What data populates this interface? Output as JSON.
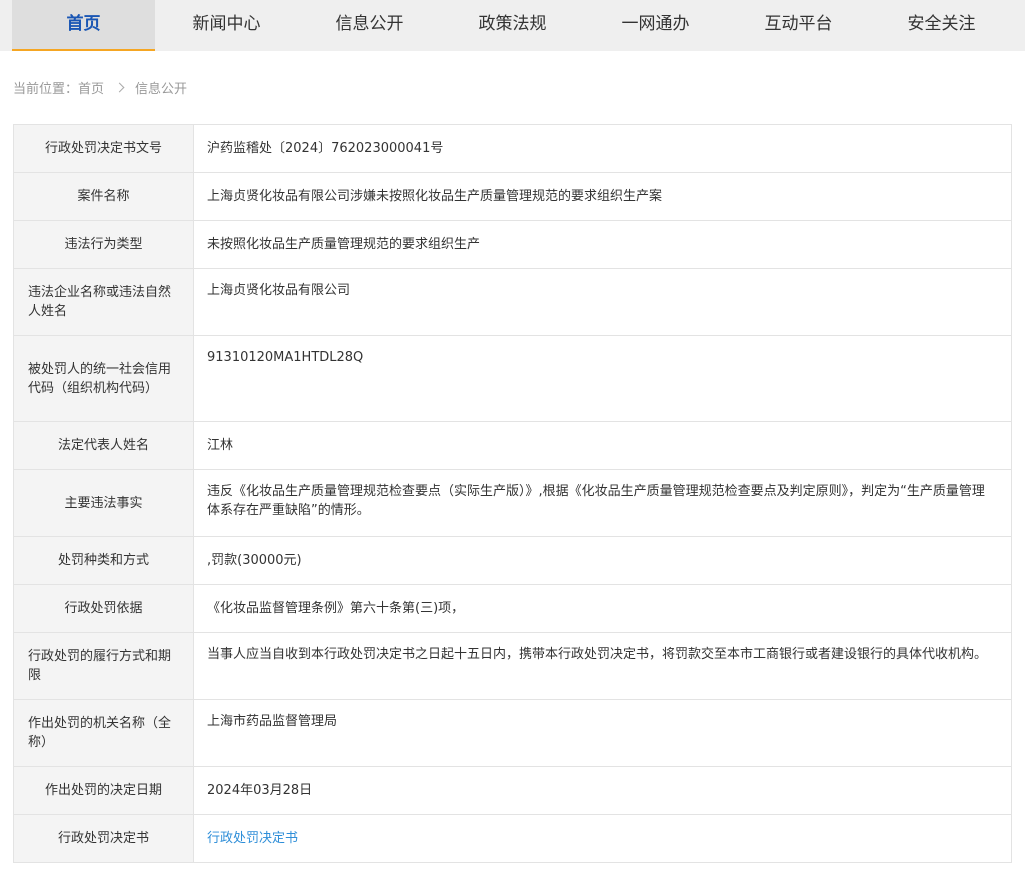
{
  "nav": {
    "items": [
      {
        "label": "首页",
        "active": true
      },
      {
        "label": "新闻中心"
      },
      {
        "label": "信息公开"
      },
      {
        "label": "政策法规"
      },
      {
        "label": "一网通办"
      },
      {
        "label": "互动平台"
      },
      {
        "label": "安全关注"
      }
    ],
    "active_color": "#1a56b4",
    "underline_color": "#f5a623"
  },
  "breadcrumb": {
    "prefix": "当前位置：",
    "home": "首页",
    "current": "信息公开"
  },
  "detail": {
    "rows": [
      {
        "label": "行政处罚决定书文号",
        "value": "沪药监稽处〔2024〕762023000041号"
      },
      {
        "label": "案件名称",
        "value": "上海贞贤化妆品有限公司涉嫌未按照化妆品生产质量管理规范的要求组织生产案"
      },
      {
        "label": "违法行为类型",
        "value": "未按照化妆品生产质量管理规范的要求组织生产"
      },
      {
        "label": "违法企业名称或违法自然人姓名",
        "value": "上海贞贤化妆品有限公司"
      },
      {
        "label": "被处罚人的统一社会信用代码（组织机构代码）",
        "value": "91310120MA1HTDL28Q"
      },
      {
        "label": "法定代表人姓名",
        "value": "江林"
      },
      {
        "label": "主要违法事实",
        "value": "违反《化妆品生产质量管理规范检查要点（实际生产版）》,根据《化妆品生产质量管理规范检查要点及判定原则》，判定为“生产质量管理体系存在严重缺陷”的情形。"
      },
      {
        "label": "处罚种类和方式",
        "value": ",罚款(30000元)"
      },
      {
        "label": "行政处罚依据",
        "value": "《化妆品监督管理条例》第六十条第(三)项，"
      },
      {
        "label": "行政处罚的履行方式和期限",
        "value": "当事人应当自收到本行政处罚决定书之日起十五日内，携带本行政处罚决定书，将罚款交至本市工商银行或者建设银行的具体代收机构。"
      },
      {
        "label": "作出处罚的机关名称（全称）",
        "value": "上海市药品监督管理局"
      },
      {
        "label": "作出处罚的决定日期",
        "value": "2024年03月28日"
      },
      {
        "label": "行政处罚决定书",
        "value": "行政处罚决定书"
      }
    ],
    "link_color": "#2e8ed8"
  }
}
